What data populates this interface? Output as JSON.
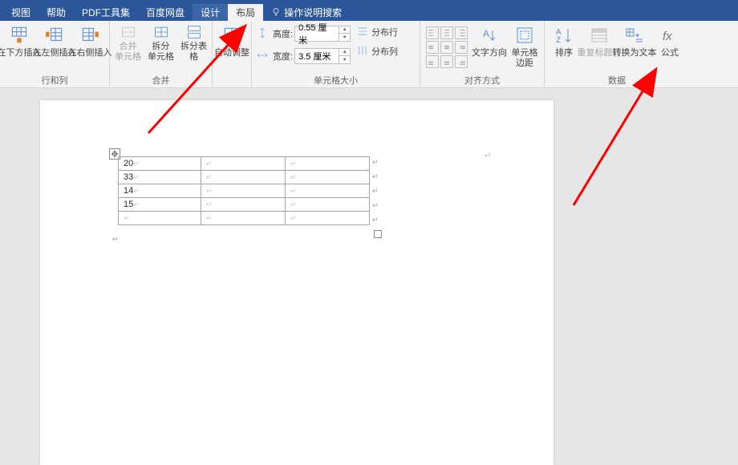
{
  "menu": {
    "view": "视图",
    "help": "帮助",
    "pdf_tools": "PDF工具集",
    "baidu_disk": "百度网盘",
    "design": "设计",
    "layout": "布局",
    "tell_me": "操作说明搜索"
  },
  "ribbon": {
    "rows_cols": {
      "insert_below": "在下方插入",
      "insert_left": "在左侧插入",
      "insert_right": "在右侧插入",
      "group": "行和列"
    },
    "merge": {
      "merge_cells_1": "合并",
      "merge_cells_2": "单元格",
      "split_cells_1": "拆分",
      "split_cells_2": "单元格",
      "split_table_1": "拆分表",
      "split_table_2": "格",
      "group": "合并"
    },
    "autofit": "自动调整",
    "cell_size": {
      "height_lbl": "高度:",
      "height_val": "0.55 厘米",
      "width_lbl": "宽度:",
      "width_val": "3.5 厘米",
      "dist_rows": "分布行",
      "dist_cols": "分布列",
      "group": "单元格大小"
    },
    "align": {
      "text_dir": "文字方向",
      "cell_margin_1": "单元格",
      "cell_margin_2": "边距",
      "group": "对齐方式"
    },
    "data": {
      "sort": "排序",
      "repeat_header": "重复标题行",
      "to_text": "转换为文本",
      "formula": "公式",
      "group": "数据"
    }
  },
  "table": {
    "r1": "20",
    "r2": "33",
    "r3": "14",
    "r4": "15",
    "r5": ""
  }
}
